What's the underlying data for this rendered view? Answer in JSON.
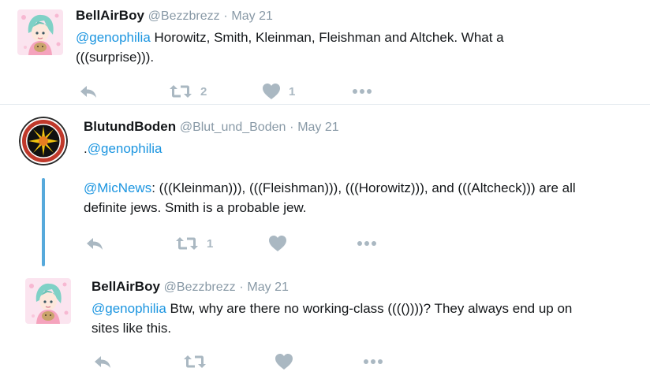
{
  "tweets": [
    {
      "name": "BellAirBoy",
      "handle": "@Bezzbrezz",
      "sep": "·",
      "date": "May 21",
      "mention": "@genophilia",
      "text_line1": " Horowitz, Smith, Kleinman, Fleishman and Altchek. What a",
      "text_line2": "(((surprise))).",
      "retweet_count": "2",
      "like_count": "1"
    },
    {
      "name": "BlutundBoden",
      "handle": "@Blut_und_Boden",
      "sep": "·",
      "date": "May 21",
      "line1_prefix": ".",
      "line1_mention": "@genophilia",
      "line2_mention": "@MicNews",
      "line2_text": ": (((Kleinman))), (((Fleishman))), (((Horowitz))), and (((Altcheck))) are all",
      "line3_text": "definite jews. Smith is a probable jew.",
      "retweet_count": "1"
    },
    {
      "name": "BellAirBoy",
      "handle": "@Bezzbrezz",
      "sep": "·",
      "date": "May 21",
      "mention": "@genophilia",
      "text_line1": " Btw, why are there no working-class (((())))? They always end up on",
      "text_line2": "sites like this."
    }
  ],
  "icons": [
    "reply-icon",
    "retweet-icon",
    "like-icon",
    "more-icon",
    "avatar-anime",
    "avatar-sun-emblem"
  ],
  "colors": {
    "link": "#1b95e0",
    "meta": "#8899a6",
    "action": "#aab8c2",
    "thread": "#56a9db"
  }
}
